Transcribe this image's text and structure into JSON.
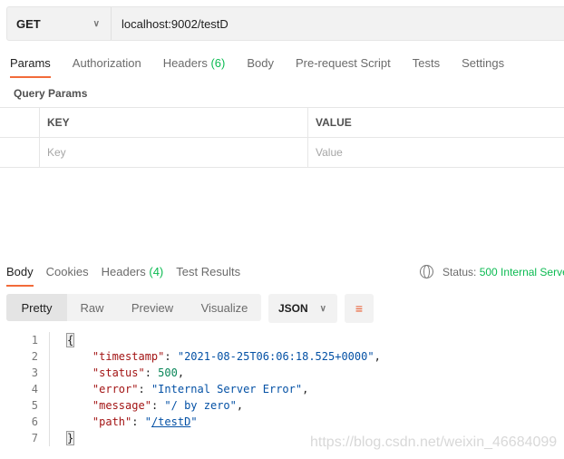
{
  "request": {
    "method": "GET",
    "url": "localhost:9002/testD"
  },
  "request_tabs": [
    {
      "label": "Params",
      "active": true
    },
    {
      "label": "Authorization"
    },
    {
      "label": "Headers",
      "count": "(6)"
    },
    {
      "label": "Body"
    },
    {
      "label": "Pre-request Script"
    },
    {
      "label": "Tests"
    },
    {
      "label": "Settings"
    }
  ],
  "query_params": {
    "title": "Query Params",
    "key_header": "KEY",
    "value_header": "VALUE",
    "key_placeholder": "Key",
    "value_placeholder": "Value"
  },
  "response_tabs": [
    {
      "label": "Body",
      "active": true
    },
    {
      "label": "Cookies"
    },
    {
      "label": "Headers",
      "count": "(4)"
    },
    {
      "label": "Test Results"
    }
  ],
  "status": {
    "label": "Status:",
    "value": "500 Internal Serve",
    "icon": "globe-icon"
  },
  "view_modes": [
    "Pretty",
    "Raw",
    "Preview",
    "Visualize"
  ],
  "format": "JSON",
  "wrap_icon": "wrap-lines-icon",
  "code": {
    "lines": [
      "1",
      "2",
      "3",
      "4",
      "5",
      "6",
      "7"
    ],
    "open": "{",
    "close": "}",
    "timestamp_key": "\"timestamp\"",
    "timestamp_val": "\"2021-08-25T06:06:18.525+0000\"",
    "status_key": "\"status\"",
    "status_val": "500",
    "error_key": "\"error\"",
    "error_val": "\"Internal Server Error\"",
    "message_key": "\"message\"",
    "message_val": "\"/ by zero\"",
    "path_key": "\"path\"",
    "path_val": "/testD"
  },
  "watermark": "https://blog.csdn.net/weixin_46684099",
  "colors": {
    "accent": "#f26b3a",
    "status_green": "#0cbb52"
  }
}
